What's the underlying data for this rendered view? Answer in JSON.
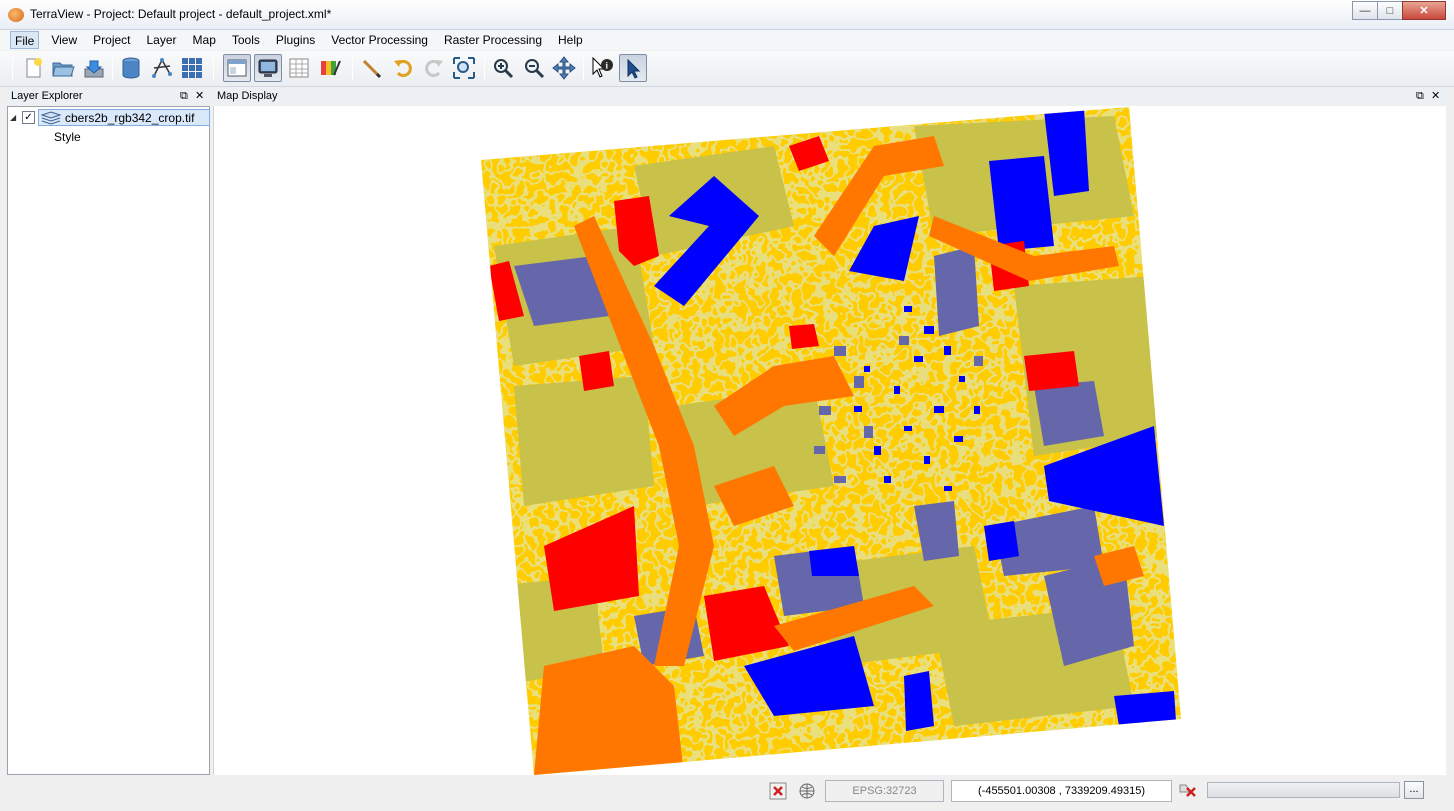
{
  "window": {
    "title": "TerraView - Project: Default project - default_project.xml*",
    "minimize": "—",
    "maximize": "□",
    "close": "✕"
  },
  "menu": {
    "items": [
      "File",
      "View",
      "Project",
      "Layer",
      "Map",
      "Tools",
      "Plugins",
      "Vector Processing",
      "Raster Processing",
      "Help"
    ],
    "active": "File"
  },
  "toolbar": {
    "icons": [
      "new-project-icon",
      "open-folder-icon",
      "save-icon",
      "database-icon",
      "vector-data-icon",
      "grid-data-icon",
      "view-layout-icon",
      "display-icon",
      "table-icon",
      "style-explorer-icon",
      "pencil-icon",
      "undo-icon",
      "redo-icon",
      "zoom-extent-icon",
      "zoom-in-icon",
      "zoom-out-icon",
      "pan-icon",
      "info-icon",
      "pointer-icon"
    ]
  },
  "layer_explorer": {
    "title": "Layer Explorer",
    "float": "⧉",
    "close": "✕",
    "layers": [
      {
        "name": "cbers2b_rgb342_crop.tif",
        "checked": true,
        "child": "Style"
      }
    ],
    "checkmark": "✓",
    "expand_arrow": "◢"
  },
  "map_display": {
    "title": "Map Display",
    "float": "⧉",
    "close": "✕",
    "palette": {
      "yellow": "#ffcc00",
      "olive": "#c8c14a",
      "blue": "#0000ff",
      "slate": "#6666aa",
      "red": "#ff0000",
      "orange": "#ff7700"
    }
  },
  "statusbar": {
    "srs": "EPSG:32723",
    "coordinates": "(-455501.00308 , 7339209.49315)",
    "more": "..."
  }
}
